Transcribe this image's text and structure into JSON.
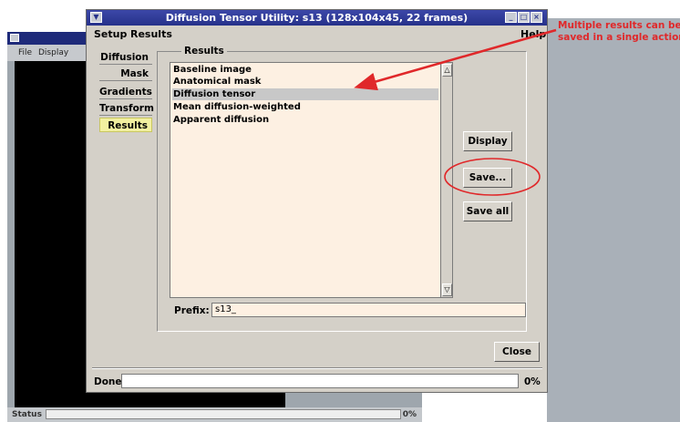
{
  "background_window": {
    "menu": [
      "File",
      "Display"
    ],
    "status_label": "Status",
    "status_pct": "0%"
  },
  "dialog": {
    "title": "Diffusion Tensor Utility: s13 (128x104x45, 22 frames)",
    "menu": {
      "setup": "Setup",
      "results": "Results",
      "help": "Help"
    },
    "tabs": [
      "Diffusion",
      "Mask",
      "Gradients",
      "Transform",
      "Results"
    ],
    "active_tab": "Results",
    "results_group": {
      "legend": "Results",
      "items": [
        "Baseline image",
        "Anatomical mask",
        "Diffusion tensor",
        "Mean diffusion-weighted",
        "Apparent diffusion"
      ],
      "selected": "Diffusion tensor"
    },
    "buttons": {
      "display": "Display",
      "save": "Save...",
      "save_all": "Save all",
      "close": "Close"
    },
    "prefix": {
      "label": "Prefix:",
      "value": "s13_"
    },
    "status": {
      "label": "Done",
      "pct": "0%",
      "progress": 0
    }
  },
  "annotation": {
    "lines": [
      "Multiple results can be",
      "saved in a single action"
    ],
    "color": "#e0282a"
  },
  "colors": {
    "title_bar": "#26318a",
    "list_background": "#fdf0e2",
    "active_tab": "#f2f0a0",
    "dialog_face": "#d4d0c8"
  }
}
